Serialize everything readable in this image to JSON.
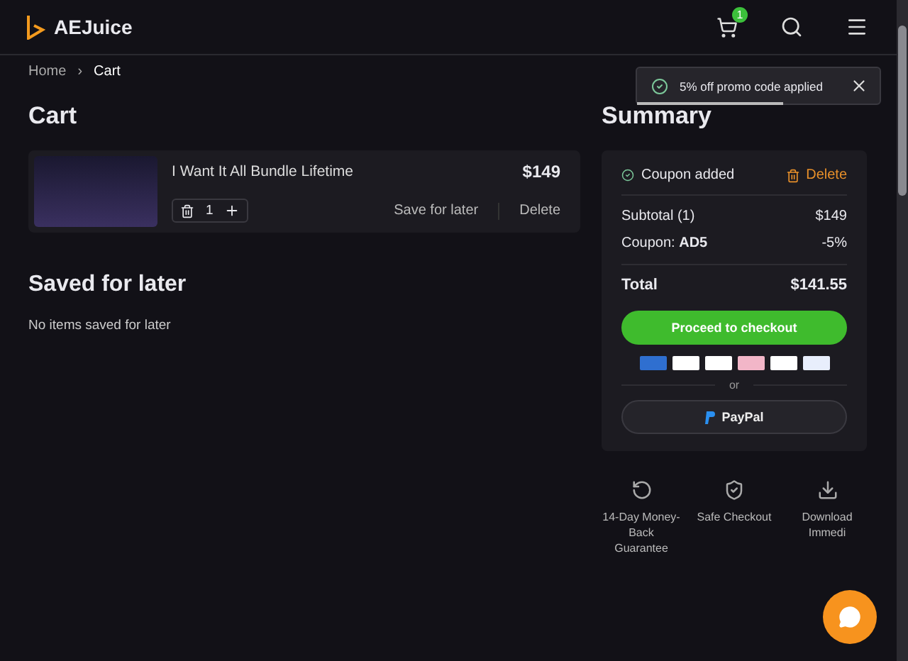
{
  "header": {
    "logo": "AEJuice",
    "cart_count": "1"
  },
  "breadcrumb_separator": "›",
  "breadcrumb": [
    {
      "label": "Home",
      "selected": false
    },
    {
      "label": "Cart",
      "selected": true
    }
  ],
  "toast": {
    "message": "5% off promo code applied",
    "level": 0.6
  },
  "cart": {
    "title": "Cart",
    "items": [
      {
        "name": "I Want It All Bundle Lifetime",
        "price": "$149",
        "quantity": "1",
        "save_label": "Save for later",
        "delete_label": "Delete"
      }
    ]
  },
  "saved": {
    "title": "Saved for later",
    "empty": "No items saved for later"
  },
  "summary": {
    "title": "Summary",
    "coupon_status": "Coupon added",
    "coupon_delete": "Delete",
    "lines": [
      {
        "label": "Subtotal (1)",
        "value": "$149"
      },
      {
        "label": "Coupon: **AD5**",
        "value": "-5%"
      }
    ],
    "total_label": "Total",
    "total_value": "$141.55",
    "checkout": "Proceed to checkout",
    "or": "or",
    "paypal": "PayPal"
  },
  "features": [
    {
      "kind": "refund",
      "text": "14-Day Money-Back Guarantee"
    },
    {
      "kind": "shield",
      "text": "Safe Checkout"
    },
    {
      "kind": "download",
      "text": "Download Immedi"
    }
  ]
}
